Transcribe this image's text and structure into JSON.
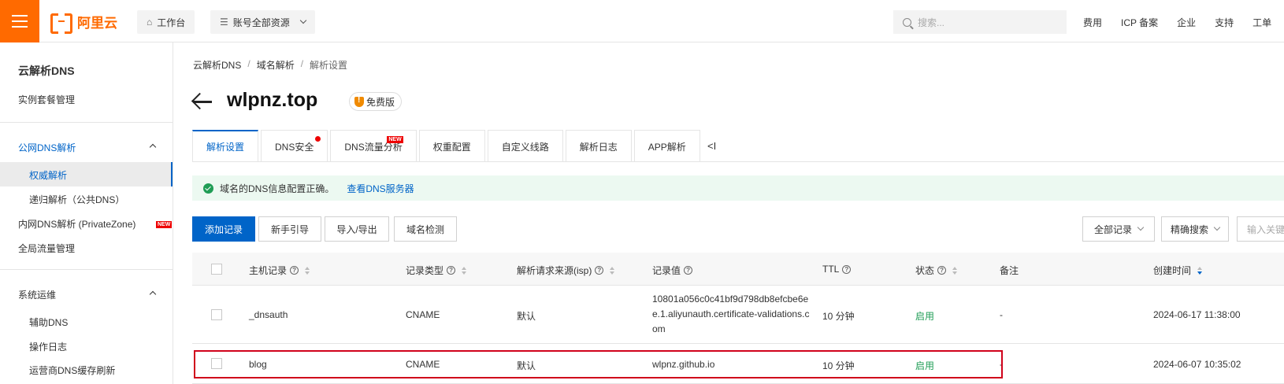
{
  "topbar": {
    "logo_text": "阿里云",
    "workbench": "工作台",
    "resources": "账号全部资源",
    "search_placeholder": "搜索...",
    "links": [
      "费用",
      "ICP 备案",
      "企业",
      "支持",
      "工单"
    ]
  },
  "sidebar": {
    "title": "云解析DNS",
    "instance": "实例套餐管理",
    "public_group": "公网DNS解析",
    "authoritative": "权威解析",
    "recursive": "递归解析（公共DNS）",
    "private_zone": "内网DNS解析 (PrivateZone)",
    "private_badge": "NEW",
    "global_traffic": "全局流量管理",
    "ops_group": "系统运维",
    "aux_dns": "辅助DNS",
    "op_log": "操作日志",
    "isp_refresh": "运营商DNS缓存刷新"
  },
  "breadcrumb": [
    "云解析DNS",
    "域名解析",
    "解析设置"
  ],
  "page": {
    "domain": "wlpnz.top",
    "edition": "免费版"
  },
  "tabs": [
    {
      "label": "解析设置"
    },
    {
      "label": "DNS安全"
    },
    {
      "label": "DNS流量分析",
      "badge": "NEW"
    },
    {
      "label": "权重配置"
    },
    {
      "label": "自定义线路"
    },
    {
      "label": "解析日志"
    },
    {
      "label": "APP解析"
    }
  ],
  "tab_collapse": "<I",
  "alert": {
    "text": "域名的DNS信息配置正确。",
    "link": "查看DNS服务器"
  },
  "toolbar": {
    "add": "添加记录",
    "guide": "新手引导",
    "import_export": "导入/导出",
    "check": "域名检测",
    "filter": "全部记录",
    "precise": "精确搜索",
    "keyword_placeholder": "输入关键"
  },
  "table": {
    "headers": {
      "host": "主机记录",
      "type": "记录类型",
      "isp": "解析请求来源(isp)",
      "value": "记录值",
      "ttl": "TTL",
      "status": "状态",
      "remark": "备注",
      "created": "创建时间"
    },
    "rows": [
      {
        "host": "_dnsauth",
        "type": "CNAME",
        "isp": "默认",
        "value": "10801a056c0c41bf9d798db8efcbe6ee.1.aliyunauth.certificate-validations.com",
        "ttl": "10 分钟",
        "status": "启用",
        "remark": "-",
        "created": "2024-06-17 11:38:00"
      },
      {
        "host": "blog",
        "type": "CNAME",
        "isp": "默认",
        "value": "wlpnz.github.io",
        "ttl": "10 分钟",
        "status": "启用",
        "remark": "-",
        "created": "2024-06-07 10:35:02"
      }
    ]
  },
  "colors": {
    "brand": "#ff6a00",
    "primary": "#0064c8",
    "success": "#1f9d55",
    "highlight": "#d0021b"
  }
}
